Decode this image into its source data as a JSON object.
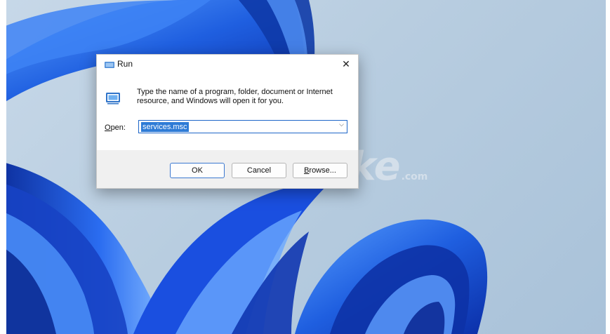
{
  "window": {
    "title": "Run",
    "close_glyph": "✕",
    "title_icon": "run-window-icon"
  },
  "content": {
    "icon": "run-program-icon",
    "instructions": "Type the name of a program, folder, document or Internet resource, and Windows will open it for you."
  },
  "open_field": {
    "label_accel": "O",
    "label_rest": "pen:",
    "value": "services.msc",
    "dropdown_glyph": "⌵"
  },
  "buttons": {
    "ok": "OK",
    "cancel": "Cancel",
    "browse_accel": "B",
    "browse_rest": "rowse..."
  },
  "watermark": {
    "brand": "TipsMake",
    "suffix": ".com"
  },
  "colors": {
    "accent": "#1e66c8",
    "selection": "#2e7bd6",
    "footer": "#f0f0f0",
    "wallpaper_blue": "#1f4fd8"
  }
}
